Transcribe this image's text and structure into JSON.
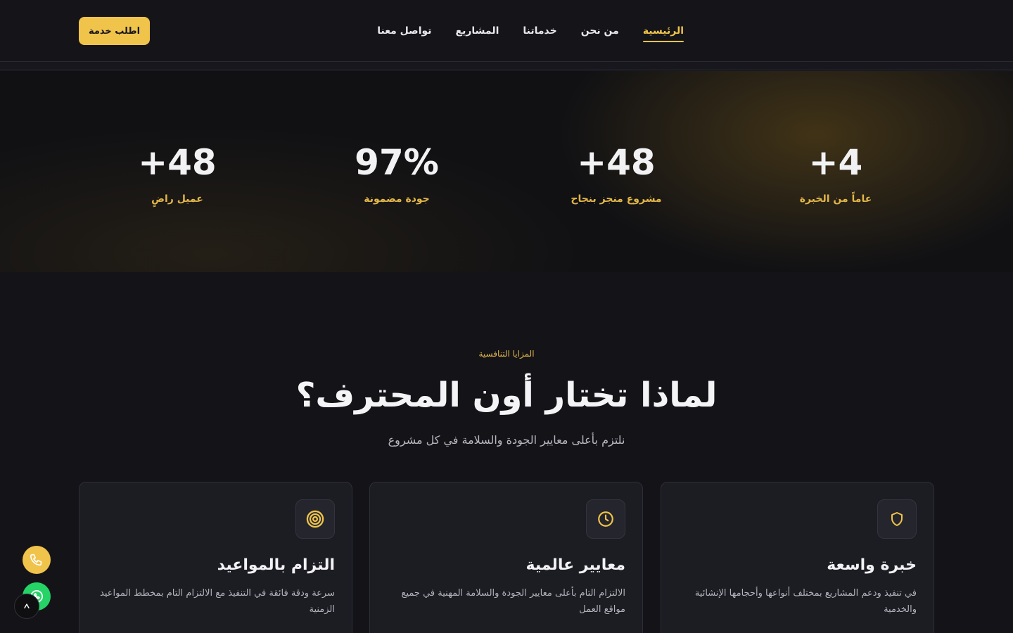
{
  "header": {
    "nav": [
      {
        "label": "الرئيسية",
        "active": true
      },
      {
        "label": "من نحن",
        "active": false
      },
      {
        "label": "خدماتنا",
        "active": false
      },
      {
        "label": "المشاريع",
        "active": false
      },
      {
        "label": "تواصل معنا",
        "active": false
      }
    ],
    "cta_label": "اطلب خدمة"
  },
  "stats": [
    {
      "value": "+4",
      "label": "عاماً من الخبرة"
    },
    {
      "value": "+48",
      "label": "مشروع منجز بنجاح"
    },
    {
      "value": "97%",
      "label": "جودة مضمونة"
    },
    {
      "value": "+48",
      "label": "عميل راضٍ"
    }
  ],
  "features": {
    "eyebrow": "المزايا التنافسية",
    "title": "لماذا تختار أون المحترف؟",
    "subtitle": "نلتزم بأعلى معايير الجودة والسلامة في كل مشروع",
    "cards": [
      {
        "icon": "shield-icon",
        "title": "خبرة واسعة",
        "text": "في تنفيذ ودعم المشاريع بمختلف أنواعها وأحجامها الإنشائية والخدمية"
      },
      {
        "icon": "clock-icon",
        "title": "معايير عالمية",
        "text": "الالتزام التام بأعلى معايير الجودة والسلامة المهنية في جميع مواقع العمل"
      },
      {
        "icon": "target-icon",
        "title": "التزام بالمواعيد",
        "text": "سرعة ودقة فائقة في التنفيذ مع الالتزام التام بمخطط المواعيد الزمنية"
      }
    ]
  },
  "colors": {
    "accent": "#f0c34b",
    "background": "#141418",
    "card": "#1c1c23",
    "whatsapp": "#25d366"
  },
  "floating": {
    "phone_icon": "phone-icon",
    "whatsapp_icon": "whatsapp-icon",
    "top_icon": "chevron-up-icon"
  }
}
